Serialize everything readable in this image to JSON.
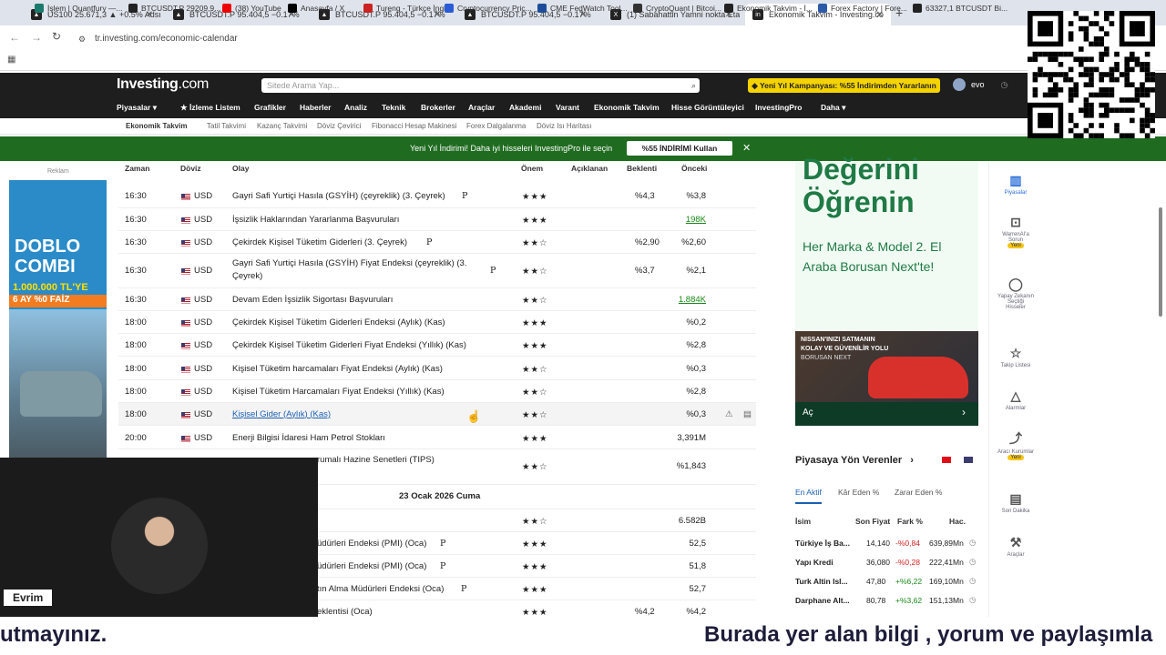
{
  "browser": {
    "tabs": [
      {
        "label": "US100 25.671,3 ▲ +0.5% Adsız",
        "icon": "chart-icon"
      },
      {
        "label": "BTCUSDT.P 95.404,5 −0.17%",
        "icon": "tradingview-icon"
      },
      {
        "label": "BTCUSDT.P 95.404,5 −0.17%",
        "icon": "tradingview-icon"
      },
      {
        "label": "BTCUSDT.P 95.404,5 −0.17%",
        "icon": "tradingview-icon"
      },
      {
        "label": "(1) Sabahattin Yamni nokta Etai",
        "icon": "x-icon"
      },
      {
        "label": "Ekonomik Takvim - Investing.co",
        "icon": "investing-icon"
      }
    ],
    "url": "tr.investing.com/economic-calendar",
    "bookmarks": [
      "İşlem | Quantfury —...",
      "BTCUSDT.P 29209,9...",
      "(38) YouTube",
      "Anasayfa / X",
      "Tureng - Türkçe İngil...",
      "Cryptocurrency Pric...",
      "CME FedWatch Tool...",
      "CryptoQuant | Bitcoi...",
      "Ekonomik Takvim - İ...",
      "Forex Factory | Fore...",
      "63327,1 BTCUSDT Bi..."
    ]
  },
  "site": {
    "logo_main": "Investing",
    "logo_suffix": ".com",
    "search_placeholder": "Sitede Arama Yap...",
    "promo": "Yeni Yıl Kampanyası: %55 İndirimden Yararlanın",
    "user": "evo",
    "nav": [
      "Piyasalar",
      "İzleme Listem",
      "Grafikler",
      "Haberler",
      "Analiz",
      "Teknik",
      "Brokerler",
      "Araçlar",
      "Akademi",
      "Varant",
      "Ekonomik Takvim",
      "Hisse Görüntüleyici",
      "InvestingPro",
      "Daha"
    ],
    "subnav": [
      "Ekonomik Takvim",
      "Tatil Takvimi",
      "Kazanç Takvimi",
      "Döviz Çevirici",
      "Fibonacci Hesap Makinesi",
      "Forex Dalgalanma",
      "Döviz Isı Haritası"
    ],
    "banner_text": "Yeni Yıl İndirimi! Daha iyi hisseleri InvestingPro ile seçin",
    "banner_button": "%55 İNDİRİMİ Kullan",
    "ad_label": "Reklam"
  },
  "table": {
    "headers": {
      "time": "Zaman",
      "currency": "Döviz",
      "event": "Olay",
      "importance": "Önem",
      "actual": "Açıklanan",
      "forecast": "Beklenti",
      "previous": "Önceki"
    },
    "rows": [
      {
        "time": "16:30",
        "cur": "USD",
        "event": "Gayri Safi Yurtiçi Hasıla (GSYİH) (çeyreklik) (3. Çeyrek)",
        "pro": "P",
        "stars": 3,
        "forecast": "%4,3",
        "previous": "%3,8"
      },
      {
        "time": "16:30",
        "cur": "USD",
        "event": "İşsizlik Haklarından Yararlanma Başvuruları",
        "pro": "",
        "stars": 3,
        "forecast": "",
        "previous": "198K",
        "prev_green": true
      },
      {
        "time": "16:30",
        "cur": "USD",
        "event": "Çekirdek Kişisel Tüketim Giderleri  (3. Çeyrek)",
        "pro": "P",
        "stars": 2,
        "forecast": "%2,90",
        "previous": "%2,60"
      },
      {
        "time": "16:30",
        "cur": "USD",
        "event": "Gayri Safi Yurtiçi Hasıla (GSYİH) Fiyat Endeksi (çeyreklik) (3.",
        "event2": "Çeyrek)",
        "pro": "P",
        "stars": 2,
        "forecast": "%3,7",
        "previous": "%2,1"
      },
      {
        "time": "16:30",
        "cur": "USD",
        "event": "Devam Eden İşsizlik Sigortası Başvuruları",
        "pro": "",
        "stars": 2,
        "forecast": "",
        "previous": "1.884K",
        "prev_green": true
      },
      {
        "time": "18:00",
        "cur": "USD",
        "event": "Çekirdek Kişisel Tüketim Giderleri Endeksi (Aylık) (Kas)",
        "pro": "",
        "stars": 3,
        "forecast": "",
        "previous": "%0,2"
      },
      {
        "time": "18:00",
        "cur": "USD",
        "event": "Çekirdek Kişisel Tüketim Giderleri Fiyat Endeksi (Yıllık) (Kas)",
        "pro": "",
        "stars": 3,
        "forecast": "",
        "previous": "%2,8"
      },
      {
        "time": "18:00",
        "cur": "USD",
        "event": "Kişisel Tüketim harcamaları Fiyat Endeksi (Aylık) (Kas)",
        "pro": "",
        "stars": 2,
        "forecast": "",
        "previous": "%0,3"
      },
      {
        "time": "18:00",
        "cur": "USD",
        "event": "Kişisel Tüketim Harcamaları Fiyat Endeksi (Yıllık) (Kas)",
        "pro": "",
        "stars": 2,
        "forecast": "",
        "previous": "%2,8"
      },
      {
        "time": "18:00",
        "cur": "USD",
        "event": "Kişisel Gider (Aylık) (Kas)",
        "pro": "",
        "stars": 2,
        "forecast": "",
        "previous": "%0,3",
        "link": true
      },
      {
        "time": "20:00",
        "cur": "USD",
        "event": "Enerji Bilgisi İdaresi Ham Petrol Stokları",
        "pro": "",
        "stars": 3,
        "forecast": "",
        "previous": "3,391M"
      }
    ],
    "partial_rows": [
      {
        "event": "rumalı Hazine Senetleri (TIPS)",
        "stars": 2,
        "previous": "%1,843"
      },
      {
        "date": "23 Ocak 2026 Cuma"
      },
      {
        "event": "",
        "stars": 2,
        "previous": "6.582B"
      },
      {
        "event": "üdürleri Endeksi (PMI)  (Oca)",
        "pro": "P",
        "stars": 3,
        "previous": "52,5"
      },
      {
        "event": "üdürleri Endeksi (PMI)  (Oca)",
        "pro": "P",
        "stars": 3,
        "previous": "51,8"
      },
      {
        "event": "tın Alma Müdürleri Endeksi  (Oca)",
        "pro": "P",
        "stars": 3,
        "previous": "52,7"
      },
      {
        "event": "eklentisi  (Oca)",
        "stars": 3,
        "forecast": "%4,2",
        "previous": "%4,2"
      }
    ]
  },
  "left_ad": {
    "brand": "DOBLO",
    "model": "COMBI",
    "price": "1.000.000 TL'YE",
    "terms": "6 AY %0 FAİZ"
  },
  "right_ad": {
    "line1": "Değerini",
    "line2": "Öğrenin",
    "body": "Her Marka & Model 2. El Araba Borusan Next'te!",
    "banner1": "NISSAN'INIZI SATMANIN",
    "banner2": "KOLAY VE GÜVENİLİR YOLU",
    "banner3": "BORUSAN NEXT",
    "cta": "Aç"
  },
  "sidebar": [
    {
      "icon": "bar-chart-icon",
      "label": "Piyasalar"
    },
    {
      "icon": "ai-icon",
      "label": "WarrenAI'a Sorun",
      "badge": "Yeni"
    },
    {
      "icon": "lightbulb-icon",
      "label": "Yapay Zekanın Seçtiği Hisseler"
    },
    {
      "icon": "star-icon",
      "label": "Takip Listesi"
    },
    {
      "icon": "bell-icon",
      "label": "Alarmlar"
    },
    {
      "icon": "trend-icon",
      "label": "Aracı Kurumlar",
      "badge": "Yeni"
    },
    {
      "icon": "news-icon",
      "label": "Son Dakika"
    },
    {
      "icon": "wrench-icon",
      "label": "Araçlar"
    }
  ],
  "movers": {
    "title": "Piyasaya Yön Verenler",
    "tabs": [
      "En Aktif",
      "Kâr Eden %",
      "Zarar Eden %"
    ],
    "cols": [
      "İsim",
      "Son Fiyat",
      "Fark %",
      "Hac."
    ],
    "rows": [
      {
        "name": "Türkiye İş Ba...",
        "price": "14,140",
        "chg": "-%0,84",
        "vol": "639,89Mn",
        "up": false
      },
      {
        "name": "Yapı Kredi",
        "price": "36,080",
        "chg": "-%0,28",
        "vol": "222,41Mn",
        "up": false
      },
      {
        "name": "Turk Altin Isl...",
        "price": "47,80",
        "chg": "+%6,22",
        "vol": "169,10Mn",
        "up": true
      },
      {
        "name": "Darphane Alt...",
        "price": "80,78",
        "chg": "+%3,62",
        "vol": "151,13Mn",
        "up": true
      }
    ]
  },
  "webcam": {
    "name": "Evrim"
  },
  "subtitle": {
    "left": "utmayınız.",
    "right": "Burada yer alan bilgi , yorum ve paylaşımla"
  },
  "colors": {
    "header": "#1e1e1e",
    "banner": "#1f6b20",
    "promo": "#f5d300",
    "up": "#1a8a1a",
    "down": "#d42020"
  }
}
